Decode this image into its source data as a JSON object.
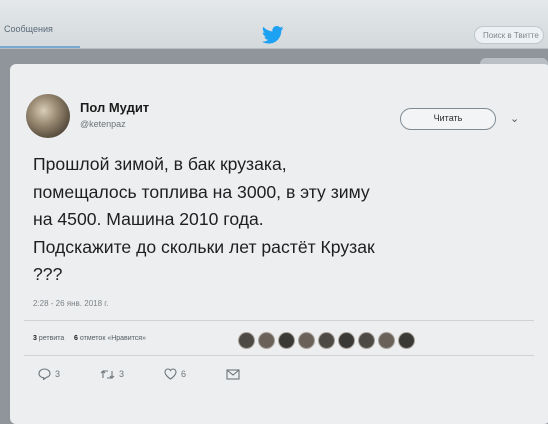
{
  "header": {
    "messages_label": "Сообщения",
    "search_placeholder": "Поиск в Твитте"
  },
  "tweet": {
    "author_name": "Пол Мудит",
    "author_handle": "@ketenpaz",
    "follow_label": "Читать",
    "text": "Прошлой зимой, в бак крузака,\nпомещалось топлива на 3000,  в эту зиму\nна 4500. Машина 2010 года.\nПодскажите до скольки лет растёт Крузак\n???",
    "timestamp": "2:28 - 26 янв. 2018 г."
  },
  "stats": {
    "retweets_count": "3",
    "retweets_label": "ретвита",
    "likes_count": "6",
    "likes_label": "отметок «Нравится»"
  },
  "actions": {
    "reply_count": "3",
    "retweet_count": "3",
    "like_count": "6"
  },
  "icons": [
    "twitter-bird-icon",
    "reply-icon",
    "retweet-icon",
    "heart-icon",
    "message-icon",
    "chevron-down-icon"
  ],
  "colors": {
    "twitter_blue": "#1da1f2",
    "card_bg": "#eceeef",
    "text": "#1e1f20"
  }
}
